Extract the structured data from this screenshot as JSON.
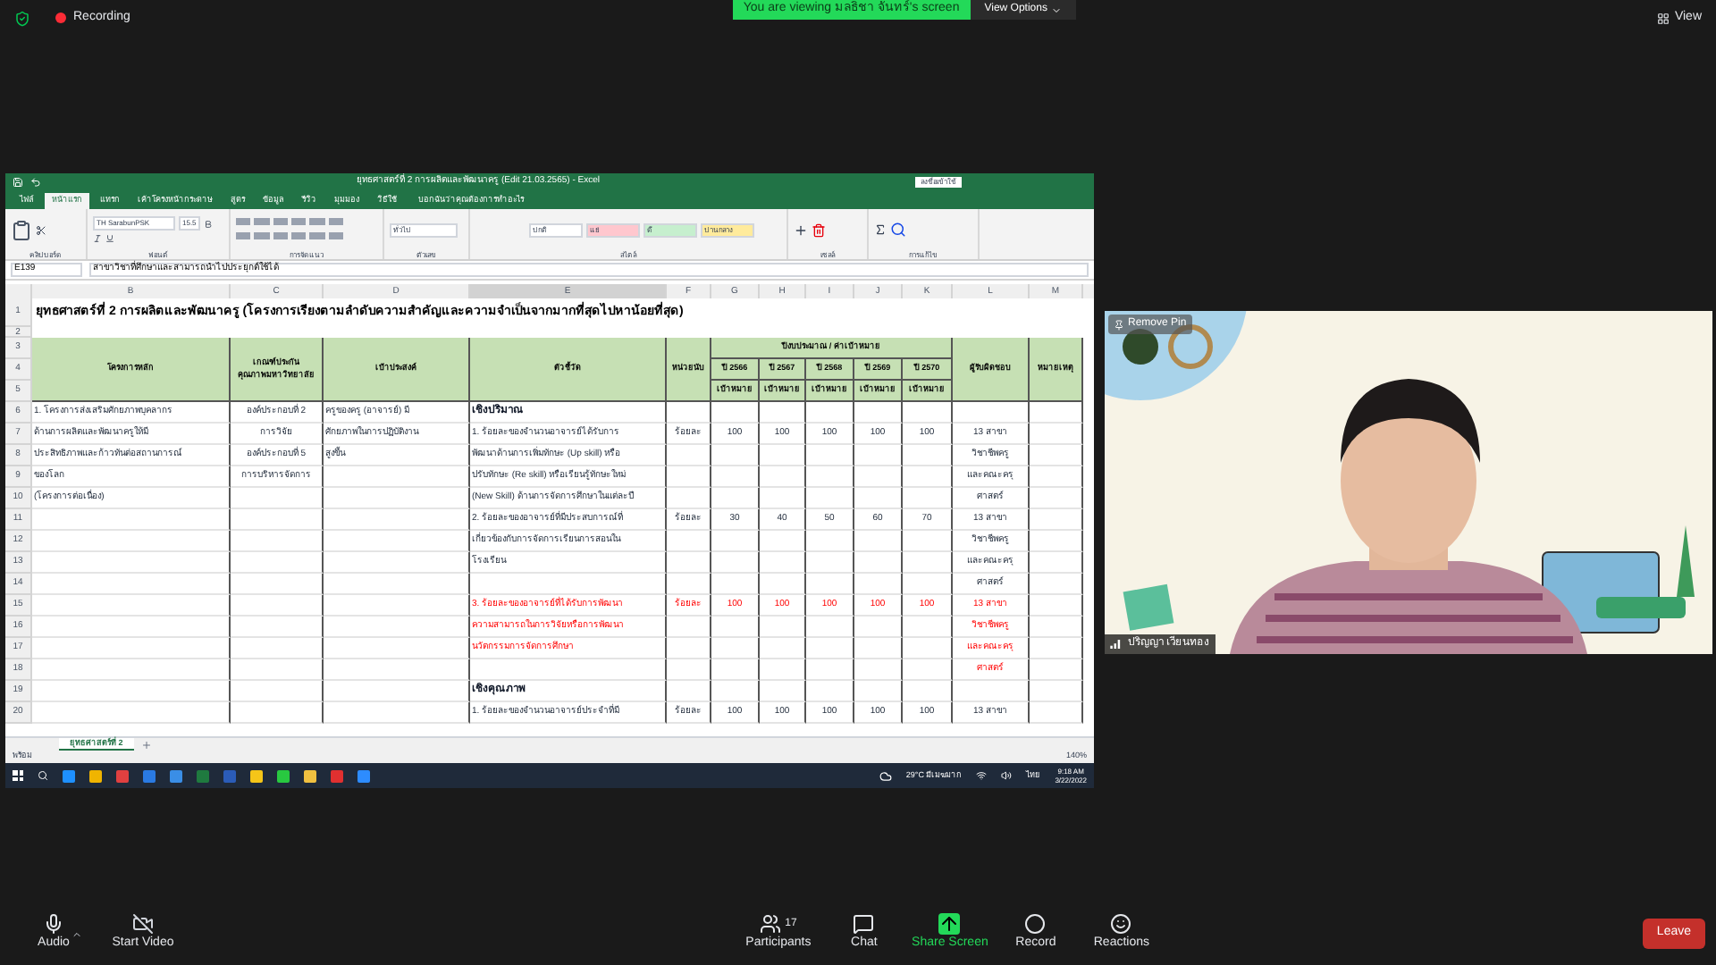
{
  "meeting_top": {
    "recording": "Recording",
    "banner": "You are viewing มลธิชา จันทร์'s screen",
    "view_options": "View Options",
    "view": "View"
  },
  "excel": {
    "title": "ยุทธศาสตร์ที่ 2 การผลิตและพัฒนาครู (Edit 21.03.2565) - Excel",
    "sign_in": "ลงชื่อเข้าใช้",
    "tabs": [
      {
        "label": "ไฟล์",
        "selected": false
      },
      {
        "label": "หน้าแรก",
        "selected": true
      },
      {
        "label": "แทรก",
        "selected": false
      },
      {
        "label": "เค้าโครงหน้ากระดาษ",
        "selected": false
      },
      {
        "label": "สูตร",
        "selected": false
      },
      {
        "label": "ข้อมูล",
        "selected": false
      },
      {
        "label": "รีวิว",
        "selected": false
      },
      {
        "label": "มุมมอง",
        "selected": false
      },
      {
        "label": "วิธีใช้",
        "selected": false
      }
    ],
    "tell_me": "บอกฉันว่าคุณต้องการทำอะไร",
    "ribbon": {
      "font_name": "TH SarabunPSK",
      "font_size": "15.5",
      "number_format": "ทั่วไป",
      "styles": [
        {
          "label": "ปกติ",
          "color": "#ffffff"
        },
        {
          "label": "แย่",
          "color": "#ffc7ce"
        },
        {
          "label": "ดี",
          "color": "#c6efce"
        },
        {
          "label": "ปานกลาง",
          "color": "#ffeb9c"
        }
      ],
      "groups": [
        "คลิปบอร์ด",
        "ฟอนต์",
        "การจัดแนว",
        "ตัวเลข",
        "สไตล์",
        "เซลล์",
        "การแก้ไข"
      ]
    },
    "name_box": "E139",
    "formula": "สาขาวิชาที่ศึกษาและสามารถนำไปประยุกต์ใช้ได้",
    "columns": [
      "B",
      "C",
      "D",
      "E",
      "F",
      "G",
      "H",
      "I",
      "J",
      "K",
      "L",
      "M"
    ],
    "sheet_title": "ยุทธศาสตร์ที่ 2 การผลิตและพัฒนาครู (โครงการเรียงตามลำดับความสำคัญและความจำเป็นจากมากที่สุดไปหาน้อยที่สุด)",
    "header": {
      "row_numbers": [
        "3",
        "4",
        "5"
      ],
      "project": "โครงการหลัก",
      "criteria": [
        "เกณฑ์ประกัน",
        "คุณภาพมหาวิทยาลัย"
      ],
      "goal": "เป้าประสงค์",
      "indicator": "ตัวชี้วัด",
      "unit": "หน่วยนับ",
      "budget": "ปีงบประมาณ / ค่าเป้าหมาย",
      "years": [
        "ปี 2566",
        "ปี 2567",
        "ปี 2568",
        "ปี 2569",
        "ปี 2570"
      ],
      "targets": [
        "เป้าหมาย",
        "เป้าหมาย",
        "เป้าหมาย",
        "เป้าหมาย",
        "เป้าหมาย"
      ],
      "owner": "ผู้รับผิดชอบ",
      "note": "หมายเหตุ"
    },
    "rows": [
      {
        "number": "1"
      },
      {
        "number": "2"
      },
      {
        "number": "6",
        "b": "1. โครงการส่งเสริมศักยภาพบุคลากร",
        "c": "องค์ประกอบที่ 2",
        "d": "ครูของครู (อาจารย์) มี",
        "e": "เชิงปริมาณ",
        "section": true,
        "flagged": false
      },
      {
        "number": "7",
        "b": "ด้านการผลิตและพัฒนาครูให้มี",
        "c": "การวิจัย",
        "d": "ศักยภาพในการปฏิบัติงาน",
        "e": "1. ร้อยละของจำนวนอาจารย์ได้รับการ",
        "f": "ร้อยละ",
        "values": [
          "100",
          "100",
          "100",
          "100",
          "100"
        ],
        "l": "13 สาขา",
        "section": false,
        "flagged": false
      },
      {
        "number": "8",
        "b": "ประสิทธิภาพและก้าวทันต่อสถานการณ์",
        "c": "องค์ประกอบที่ 5",
        "d": "สูงขึ้น",
        "e": "พัฒนาด้านการเพิ่มทักษะ (Up skill) หรือ",
        "l": "วิชาชีพครู",
        "section": false,
        "flagged": false
      },
      {
        "number": "9",
        "b": "ของโลก",
        "c": "การบริหารจัดการ",
        "e": "ปรับทักษะ (Re skill) หรือเรียนรู้ทักษะใหม่",
        "l": "และคณะครุ",
        "section": false,
        "flagged": false
      },
      {
        "number": "10",
        "b": "(โครงการต่อเนื่อง)",
        "e": "(New Skill) ด้านการจัดการศึกษาในแต่ละปี",
        "l": "ศาสตร์",
        "section": false,
        "flagged": false
      },
      {
        "number": "11",
        "e": "2. ร้อยละของอาจารย์ที่มีประสบการณ์ที่",
        "f": "ร้อยละ",
        "values": [
          "30",
          "40",
          "50",
          "60",
          "70"
        ],
        "l": "13 สาขา",
        "section": false,
        "flagged": false
      },
      {
        "number": "12",
        "e": "เกี่ยวข้องกับการจัดการเรียนการสอนใน",
        "l": "วิชาชีพครู",
        "section": false,
        "flagged": false
      },
      {
        "number": "13",
        "e": "โรงเรียน",
        "l": "และคณะครุ",
        "section": false,
        "flagged": false
      },
      {
        "number": "14",
        "l": "ศาสตร์",
        "flagged": false
      },
      {
        "number": "15",
        "e": "3. ร้อยละของอาจารย์ที่ได้รับการพัฒนา",
        "f": "ร้อยละ",
        "values": [
          "100",
          "100",
          "100",
          "100",
          "100"
        ],
        "l": "13 สาขา",
        "section": false,
        "flagged": true
      },
      {
        "number": "16",
        "e": "ความสามารถในการวิจัยหรือการพัฒนา",
        "l": "วิชาชีพครู",
        "section": false,
        "flagged": true
      },
      {
        "number": "17",
        "e": "นวัตกรรมการจัดการศึกษา",
        "l": "และคณะครุ",
        "section": false,
        "flagged": true
      },
      {
        "number": "18",
        "l": "ศาสตร์",
        "flagged": true
      },
      {
        "number": "19",
        "e": "เชิงคุณภาพ",
        "section": true,
        "flagged": false
      },
      {
        "number": "20",
        "e": "1. ร้อยละของจำนวนอาจารย์ประจำที่มี",
        "f": "ร้อยละ",
        "values": [
          "100",
          "100",
          "100",
          "100",
          "100"
        ],
        "l": "13 สาขา",
        "section": false,
        "flagged": false
      }
    ],
    "sheet_tabs": [
      {
        "label": "ยุทธศาสตร์ที่ 2",
        "selected": true
      }
    ],
    "status": "พร้อม",
    "zoom": "140%",
    "taskbar": {
      "weather": "29°C มีเมฆมาก",
      "language": "ไทย",
      "time": "9:18 AM",
      "date": "3/22/2022"
    }
  },
  "video": {
    "remove_pin": "Remove Pin",
    "participant": "ปริญญา เวียนทอง"
  },
  "toolbar": {
    "items": [
      {
        "kind": "audio",
        "label": "Audio"
      },
      {
        "kind": "video",
        "label": "Start Video"
      },
      {
        "kind": "participants",
        "label": "Participants",
        "count": "17"
      },
      {
        "kind": "chat",
        "label": "Chat"
      },
      {
        "kind": "share",
        "label": "Share Screen"
      },
      {
        "kind": "record",
        "label": "Record"
      },
      {
        "kind": "reactions",
        "label": "Reactions"
      }
    ],
    "leave": "Leave"
  }
}
